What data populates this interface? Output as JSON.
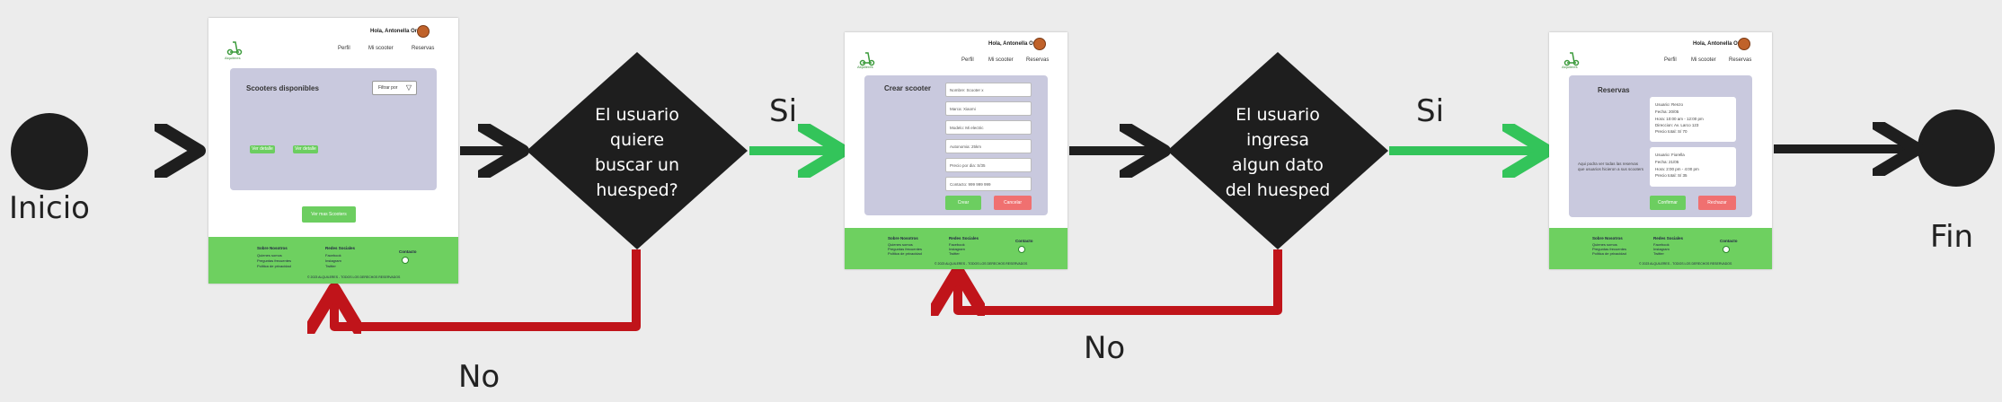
{
  "labels": {
    "inicio": "Inicio",
    "fin": "Fin",
    "si1": "Si",
    "si2": "Si",
    "no1": "No",
    "no2": "No"
  },
  "decisions": {
    "d1": [
      "El usuario",
      "quiere",
      "buscar un",
      "huesped?"
    ],
    "d2": [
      "El usuario",
      "ingresa",
      "algun dato",
      "del huesped"
    ]
  },
  "screen1": {
    "user": "Hola, Antonella Ore",
    "logo": "Alquileres",
    "nav": [
      "Perfil",
      "Mi scooter",
      "Reservas"
    ],
    "panel_title": "Scooters disponibles",
    "filter": "Filtrar por",
    "chips": [
      "Ver detalle",
      "Ver detalle"
    ],
    "cta": "Ver mas Scooters"
  },
  "screen2": {
    "user": "Hola, Antonella Ore",
    "logo": "Alquileres",
    "nav": [
      "Perfil",
      "Mi scooter",
      "Reservas"
    ],
    "panel_title": "Crear scooter",
    "fields": [
      "Nombre: Scooter x",
      "Marca: Xiaomi",
      "Modelo: Mi electric",
      "Autonomia: 25km",
      "Precio por dia: S/35",
      "Contacto: 999 999 999"
    ],
    "ok": "Crear",
    "cancel": "Cancelar"
  },
  "screen3": {
    "user": "Hola, Antonella Ore",
    "logo": "Alquileres",
    "nav": [
      "Perfil",
      "Mi scooter",
      "Reservas"
    ],
    "panel_title": "Reservas",
    "side_text": [
      "Aqui podra ver todas las reservas",
      "que usuarios hicieron a sus scooters"
    ],
    "card1": [
      "Usuario: Renzo",
      "Fecha: 20/05",
      "Hora: 10:00 am - 12:00 pm",
      "Direccion: Av. Larco 123",
      "Precio total: S/ 70"
    ],
    "card2": [
      "Usuario: Fiorella",
      "Fecha: 21/05",
      "Hora: 2:00 pm - 4:00 pm",
      "Precio total: S/ 35"
    ],
    "ok": "Confirmar",
    "cancel": "Rechazar"
  },
  "footer": {
    "c1_title": "Sobre Nosotros",
    "c1_items": [
      "Quienes somos",
      "Preguntas frecuentes",
      "Politica de privacidad"
    ],
    "c2_title": "Redes Sociales",
    "c2_items": [
      "Facebook",
      "Instagram",
      "Twitter"
    ],
    "c3_title": "Contacto",
    "copyright": "© 2023 ALQUILERES - TODOS LOS DERECHOS RESERVADOS"
  },
  "colors": {
    "dark": "#1e1e1e",
    "green": "#33c45a",
    "red": "#c0141a",
    "footer": "#6ed060",
    "panel": "#c9c9de"
  }
}
